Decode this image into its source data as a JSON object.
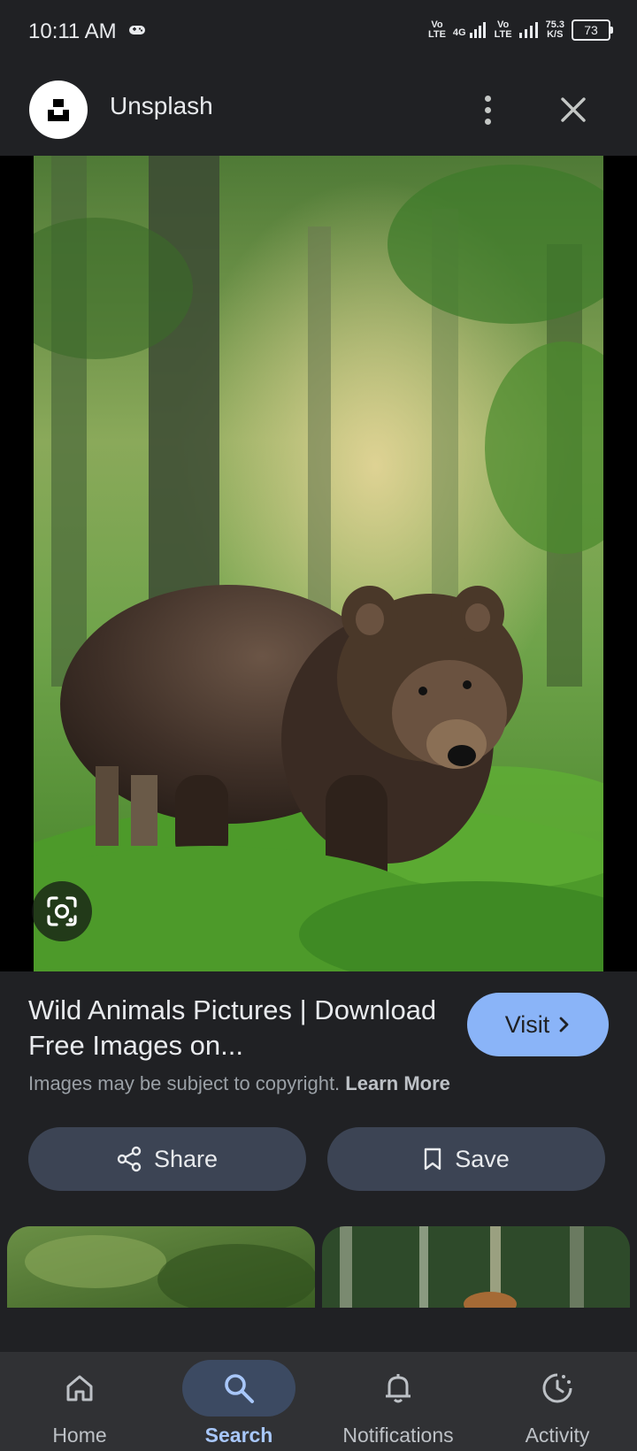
{
  "status_bar": {
    "time": "10:11 AM",
    "net1": "Vo\nLTE",
    "net_4g": "4G",
    "net2": "Vo\nLTE",
    "speed": "75.3\nK/S",
    "battery": "73"
  },
  "header": {
    "site_name": "Unsplash",
    "logo_icon": "unsplash-logo",
    "more_icon": "more-vert-icon",
    "close_icon": "close-icon"
  },
  "image": {
    "subject": "brown bear in forest"
  },
  "result": {
    "title": "Wild Animals Pictures | Download Free Images on...",
    "visit_label": "Visit",
    "copyright_text": "Images may be subject to copyright.",
    "learn_more": "Learn More"
  },
  "actions": {
    "share_label": "Share",
    "save_label": "Save"
  },
  "nav": {
    "items": [
      {
        "label": "Home",
        "icon": "home-icon",
        "active": false
      },
      {
        "label": "Search",
        "icon": "search-icon",
        "active": true
      },
      {
        "label": "Notifications",
        "icon": "bell-icon",
        "active": false
      },
      {
        "label": "Activity",
        "icon": "activity-icon",
        "active": false
      }
    ]
  },
  "colors": {
    "background": "#202124",
    "accent": "#8ab4f8",
    "button_bg": "#3c4454",
    "nav_bg": "#303134",
    "nav_active": "#a8c7fa"
  }
}
